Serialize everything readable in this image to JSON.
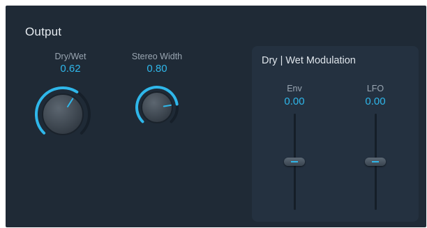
{
  "output": {
    "title": "Output",
    "dry_wet": {
      "label": "Dry/Wet",
      "value": "0.62",
      "level": 0.62
    },
    "stereo_width": {
      "label": "Stereo Width",
      "value": "0.80",
      "level": 0.8
    }
  },
  "modulation": {
    "title": "Dry | Wet Modulation",
    "env": {
      "label": "Env",
      "value": "0.00",
      "level": 0.5
    },
    "lfo": {
      "label": "LFO",
      "value": "0.00",
      "level": 0.5
    }
  },
  "colors": {
    "accent": "#2fb7ea",
    "background": "#1f2a36",
    "box_background": "#243140"
  }
}
